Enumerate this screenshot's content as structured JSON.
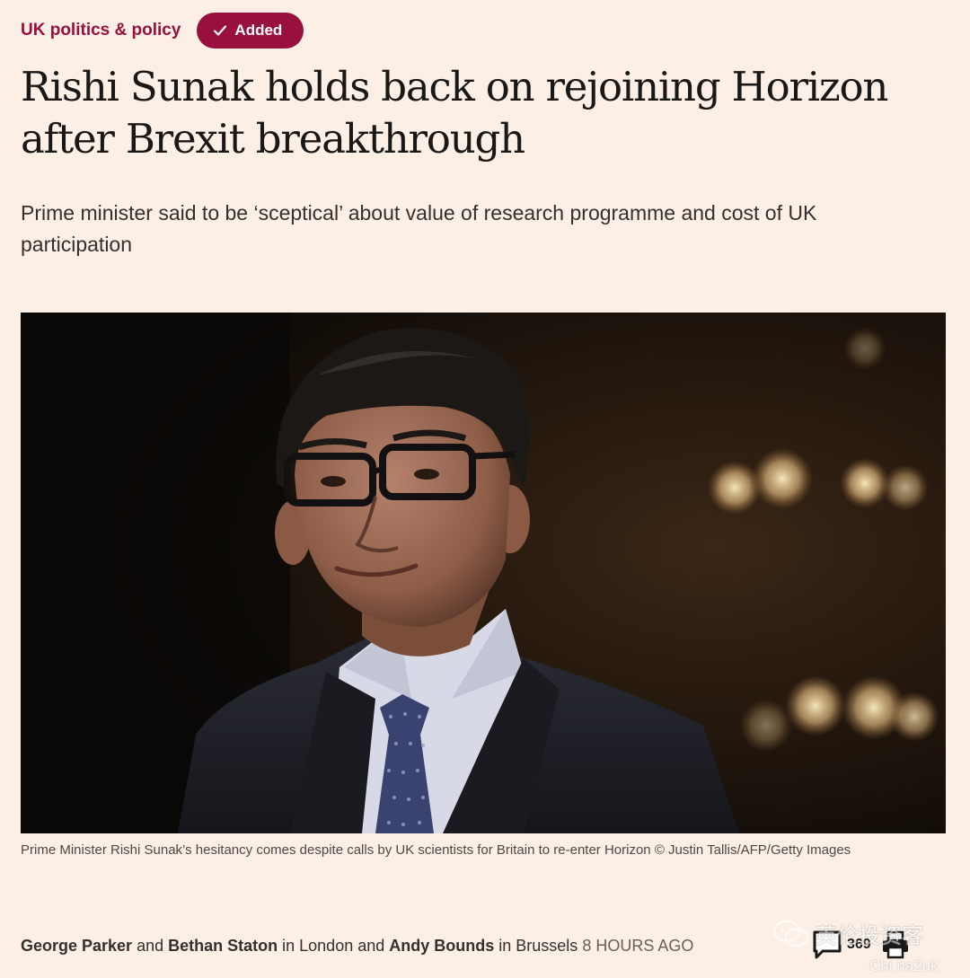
{
  "topic": {
    "label": "UK politics & policy",
    "follow_button_label": "Added",
    "follow_button_icon": "check-icon"
  },
  "article": {
    "headline": "Rishi Sunak holds back on rejoining Horizon after Brexit breakthrough",
    "standfirst": "Prime minister said to be ‘sceptical’ about value of research programme and cost of UK participation",
    "caption": "Prime Minister Rishi Sunak’s hesitancy comes despite calls by UK scientists for Britain to re-enter Horizon © Justin Tallis/AFP/Getty Images"
  },
  "byline": {
    "author1": "George Parker",
    "sep1": " and ",
    "author2": "Bethan Staton",
    "loc1": " in London and ",
    "author3": "Andy Bounds",
    "loc2": " in Brussels ",
    "time": "8 HOURS AGO"
  },
  "tools": {
    "comment_icon": "comment-icon",
    "comment_count": "369",
    "print_icon": "print-icon"
  },
  "watermark": {
    "top_text": "英伦投资客",
    "bottom_text": "Chi na2uk"
  },
  "colors": {
    "background": "#fcf0e6",
    "accent": "#990f3d",
    "text": "#33302e"
  }
}
